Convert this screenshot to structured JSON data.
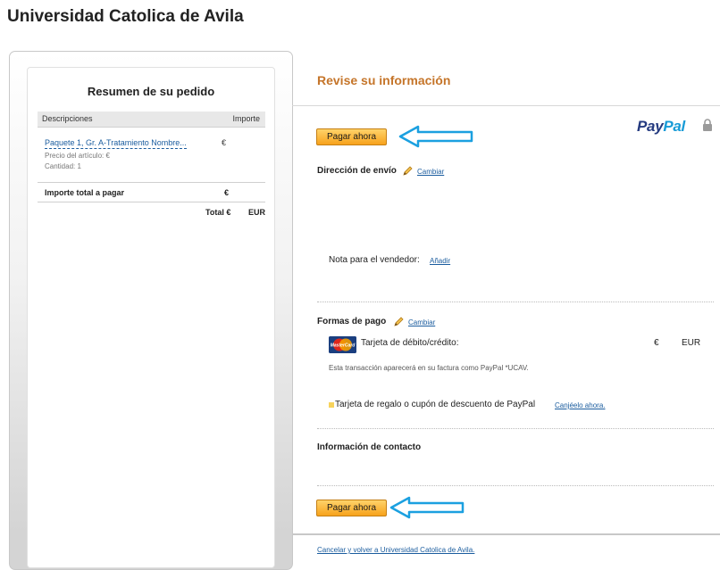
{
  "header": {
    "merchant_name": "Universidad Catolica de Avila"
  },
  "summary": {
    "title": "Resumen de su pedido",
    "col_description": "Descripciones",
    "col_amount": "Importe",
    "item": {
      "name": "Paquete 1, Gr. A-Tratamiento Nombre...",
      "price": "€",
      "unit_price": "Precio del artículo: €",
      "quantity": "Cantidad: 1"
    },
    "total_label": "Importe total a pagar",
    "total_value": "€",
    "grand_total": "Total €",
    "grand_currency": "EUR"
  },
  "review": {
    "title": "Revise su información",
    "pay_button": "Pagar ahora",
    "paypal_pay": "Pay",
    "paypal_pal": "Pal",
    "shipping_label": "Dirección de envío",
    "change_link": "Cambiar",
    "note_label": "Nota para el vendedor:",
    "note_link": "Añadir",
    "payment_label": "Formas de pago",
    "card_brand": "MasterCard",
    "card_label": "Tarjeta de débito/crédito:",
    "card_amount": "€",
    "card_currency": "EUR",
    "transaction_note": "Esta transacción aparecerá en su factura como PayPal *UCAV.",
    "gift_label": "Tarjeta de regalo o cupón de descuento de PayPal",
    "gift_link": "Canjéelo ahora.",
    "contact_label": "Información de contacto",
    "cancel_link": "Cancelar y volver a Universidad Catolica de Avila."
  },
  "colors": {
    "accent": "#c5752a",
    "button": "#f7a21c",
    "arrow": "#1ba0e0",
    "link": "#1a5c9e"
  },
  "icons": [
    "pencil-icon",
    "lock-icon",
    "mastercard-icon",
    "arrow-icon"
  ]
}
